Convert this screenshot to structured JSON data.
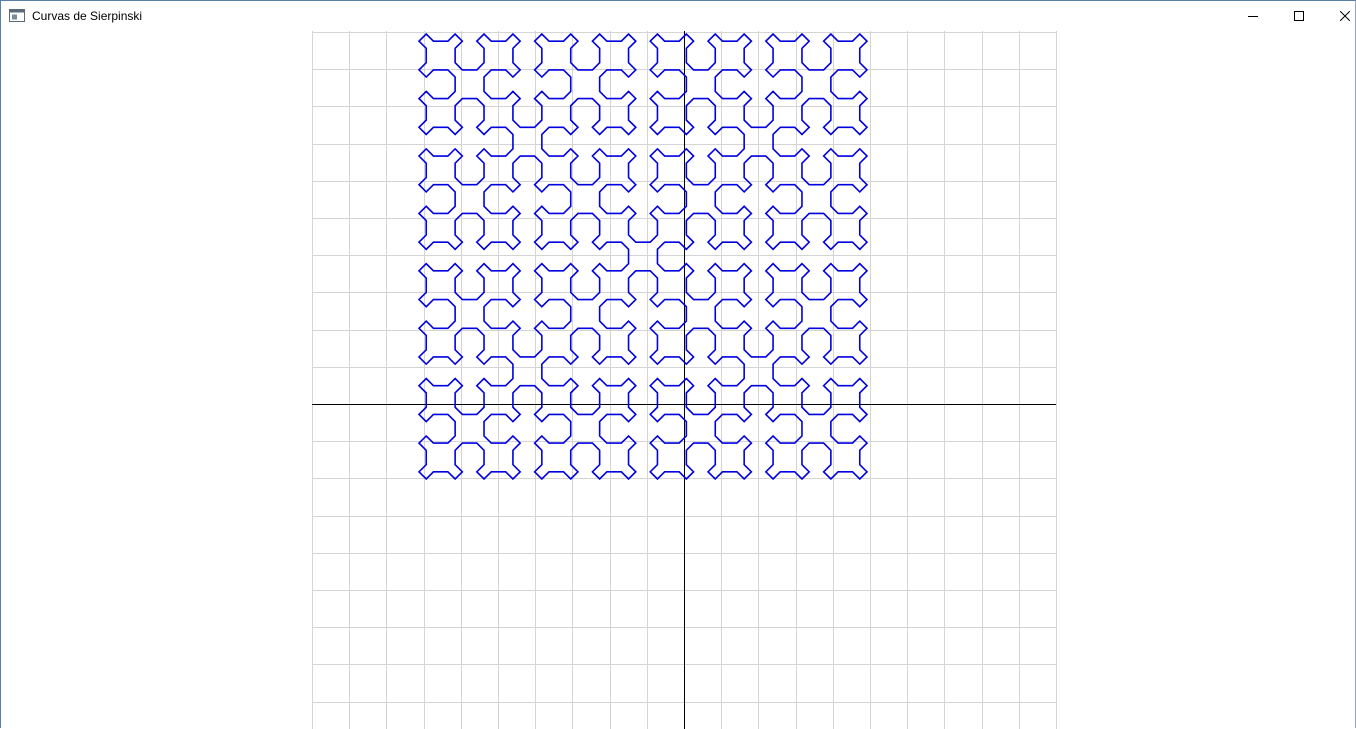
{
  "window": {
    "title": "Curvas de Sierpinski",
    "controls": {
      "minimize": "minimize-icon",
      "maximize": "maximize-icon",
      "close": "close-icon"
    }
  },
  "plot": {
    "curve": "sierpinski",
    "order": 4,
    "colors": {
      "curve": "#0000e0",
      "grid": "#d4d4d4",
      "axes": "#000000",
      "background": "#ffffff"
    }
  }
}
